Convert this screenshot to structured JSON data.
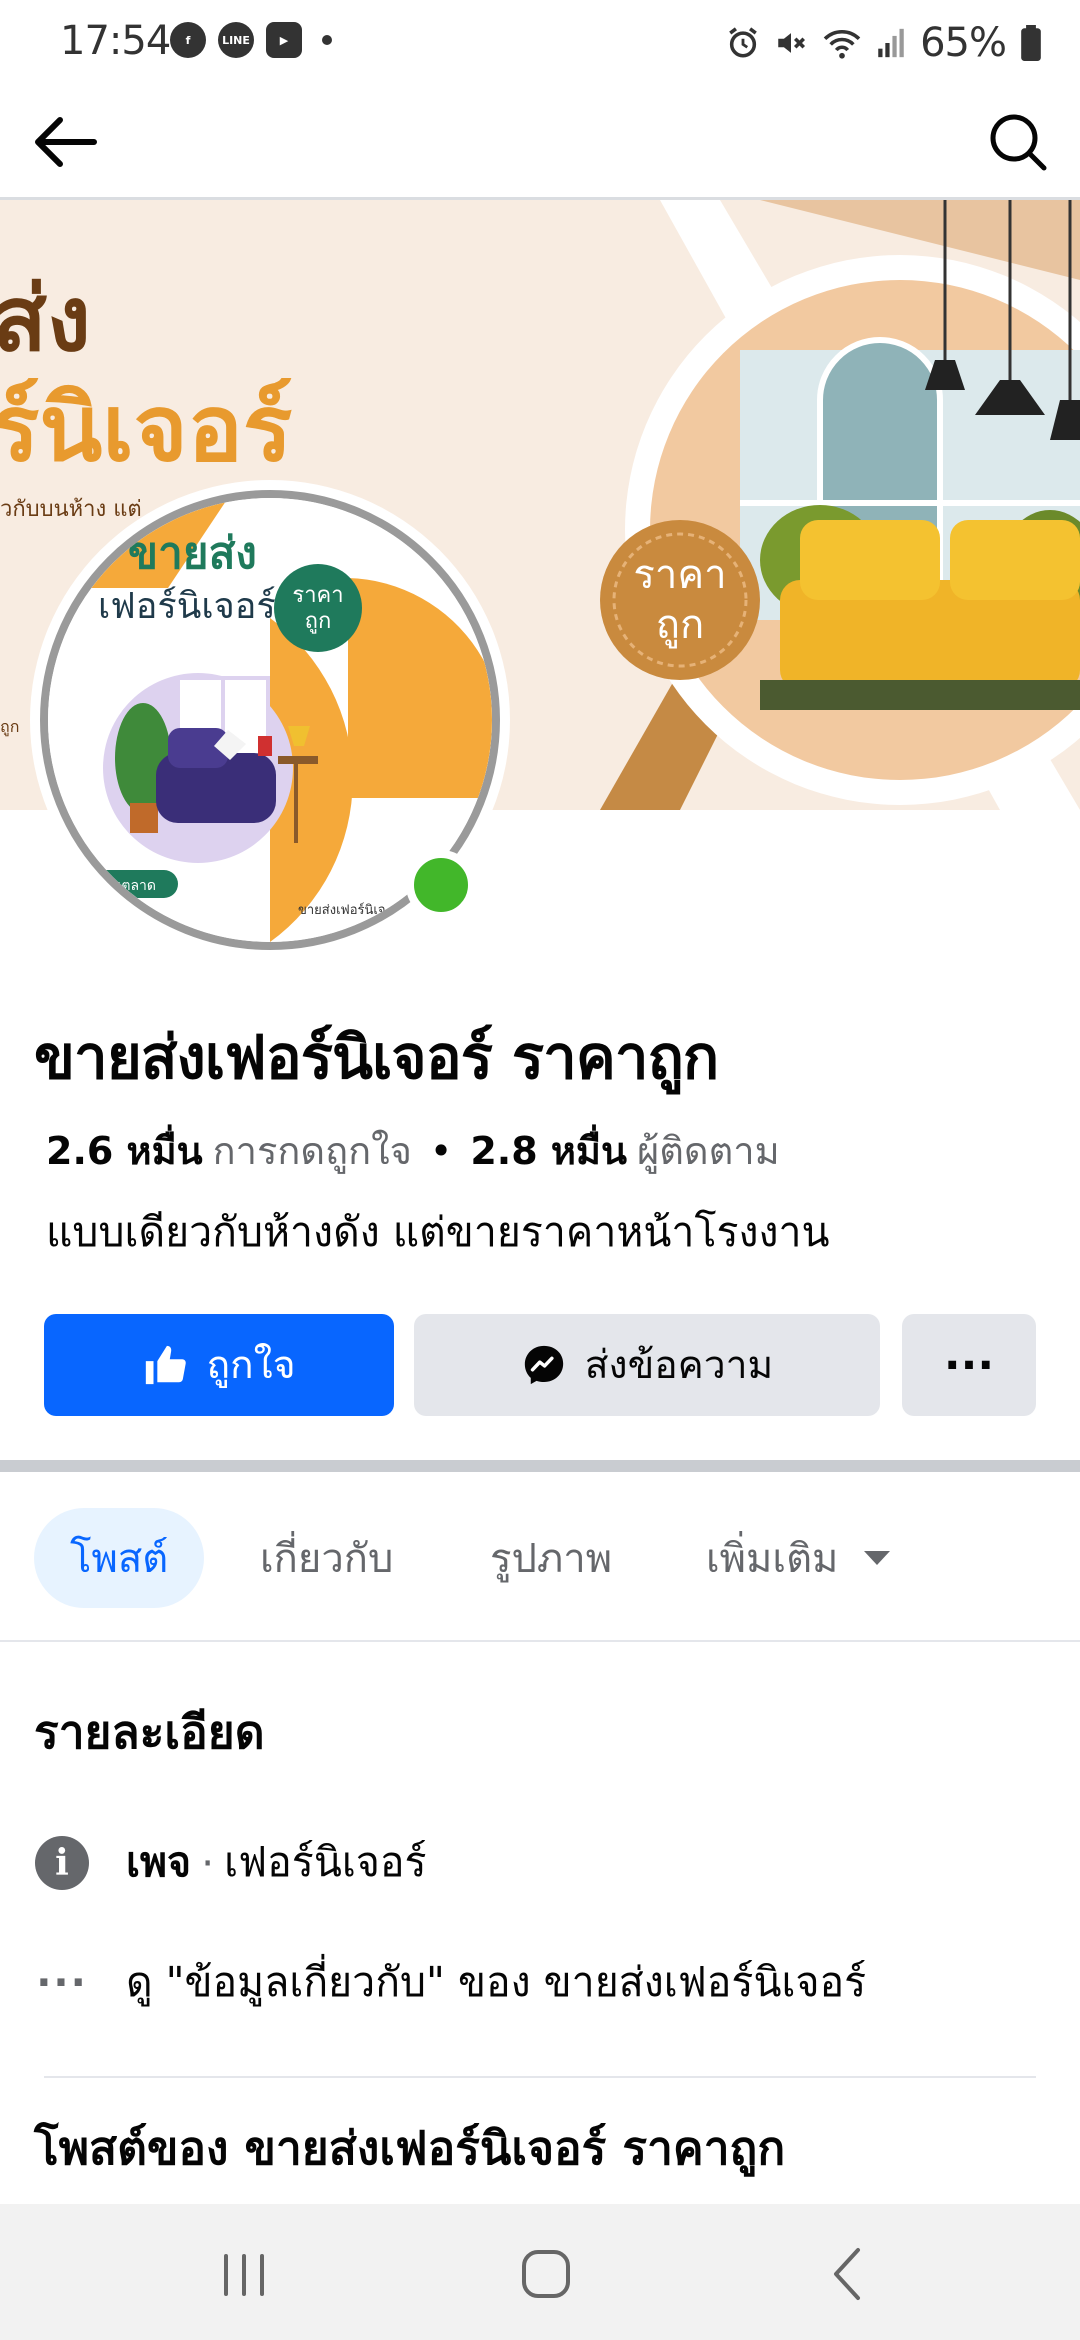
{
  "status_bar": {
    "time": "17:54",
    "battery": "65%",
    "notification_icons": [
      "facebook-icon",
      "line-icon",
      "media-icon"
    ],
    "system_icons": [
      "alarm-icon",
      "mute-icon",
      "wifi-icon",
      "signal-icon",
      "battery-icon"
    ]
  },
  "header": {
    "back_icon": "arrow-left-icon",
    "search_icon": "search-icon"
  },
  "cover": {
    "headline_1": "ส่ง",
    "headline_2": "ร์นิเจอร์",
    "subline": "วกับบนห้าง แต่",
    "badge_1": "ราคา",
    "badge_2": "ถูก",
    "side_text": "ถูก"
  },
  "avatar": {
    "title_1": "ขายส่ง",
    "title_2": "เฟอร์นิเจอร์",
    "badge_1": "ราคา",
    "badge_2": "ถูก",
    "pill": "ถูกในตลาด",
    "footer": "ขายส่งเฟอร์นิเจ",
    "tiny": "ราคา",
    "online": true
  },
  "page": {
    "name": "ขายส่งเฟอร์นิเจอร์ ราคาถูก",
    "likes_count": "2.6 หมื่น",
    "likes_label": "การกดถูกใจ",
    "separator": "•",
    "followers_count": "2.8 หมื่น",
    "followers_label": "ผู้ติดตาม",
    "bio": "แบบเดียวกับห้างดัง แต่ขายราคาหน้าโรงงาน"
  },
  "actions": {
    "like_label": "ถูกใจ",
    "message_label": "ส่งข้อความ",
    "more_label": "···"
  },
  "tabs": [
    {
      "label": "โพสต์",
      "active": true
    },
    {
      "label": "เกี่ยวกับ",
      "active": false
    },
    {
      "label": "รูปภาพ",
      "active": false
    },
    {
      "label": "เพิ่มเติม",
      "active": false
    }
  ],
  "details": {
    "heading": "รายละเอียด",
    "type_label": "เพจ",
    "type_separator": "·",
    "type_value": "เฟอร์นิเจอร์",
    "about_dots": "···",
    "about_link": "ดู \"ข้อมูลเกี่ยวกับ\" ของ ขายส่งเฟอร์นิเจอร์"
  },
  "posts": {
    "heading": "โพสต์ของ ขายส่งเฟอร์นิเจอร์ ราคาถูก"
  },
  "nav": {
    "icons": [
      "recents-icon",
      "home-icon",
      "back-icon"
    ]
  },
  "colors": {
    "brand_blue": "#0866ff",
    "secondary_button": "#e4e6eb",
    "muted_text": "#65676b",
    "online_green": "#42b72a",
    "cover_orange": "#f3a93a",
    "cover_brown": "#7a4a1e",
    "avatar_green": "#1f7a5c"
  }
}
